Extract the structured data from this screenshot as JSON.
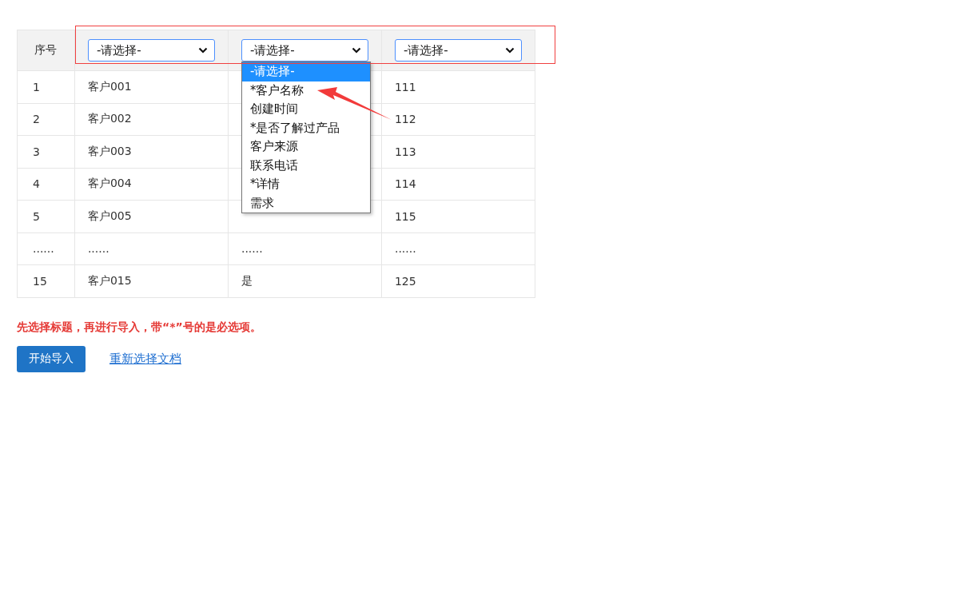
{
  "table": {
    "index_heading": "序号",
    "selects": [
      {
        "value": "-请选择-"
      },
      {
        "value": "-请选择-",
        "options": [
          {
            "label": "-请选择-",
            "selected": true
          },
          {
            "label": "*客户名称",
            "selected": false
          },
          {
            "label": "创建时间",
            "selected": false
          },
          {
            "label": "*是否了解过产品",
            "selected": false
          },
          {
            "label": "客户来源",
            "selected": false
          },
          {
            "label": "联系电话",
            "selected": false
          },
          {
            "label": "*详情",
            "selected": false
          },
          {
            "label": "需求",
            "selected": false
          }
        ]
      },
      {
        "value": "-请选择-"
      }
    ],
    "rows": [
      {
        "index": "1",
        "column_2": "客户001",
        "column_4": "111"
      },
      {
        "index": "2",
        "column_2": "客户002",
        "column_4": "112"
      },
      {
        "index": "3",
        "column_2": "客户003",
        "column_4": "113"
      },
      {
        "index": "4",
        "column_2": "客户004",
        "column_4": "114"
      },
      {
        "index": "5",
        "column_2": "客户005",
        "column_4": "115"
      },
      {
        "index": "......",
        "column_2": "......",
        "column_3": "......",
        "column_4": "......"
      },
      {
        "index": "15",
        "column_2": "客户015",
        "column_3": "是",
        "column_4": "125"
      }
    ]
  },
  "hint": "先选择标题，再进行导入，带“*”号的是必选项。",
  "start_button": "开始导入",
  "reselect_link": "重新选择文档"
}
